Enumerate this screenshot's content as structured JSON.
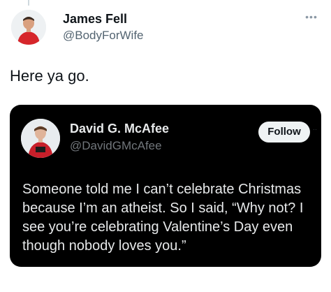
{
  "tweet": {
    "author": {
      "name": "James Fell",
      "handle": "@BodyForWife",
      "avatar_icon": "profile-photo-red-shirt"
    },
    "more_icon": "ellipsis-icon",
    "text": "Here ya go."
  },
  "quoted_tweet": {
    "author": {
      "name": "David G. McAfee",
      "handle": "@DavidGMcAfee",
      "avatar_icon": "profile-photo-red-shirt"
    },
    "follow_label": "Follow",
    "text_lines": [
      "Someone told me I can’t celebrate Christmas",
      "because I’m an atheist. So I said, “Why not? I",
      "see you’re celebrating Valentine’s Day even",
      "though nobody loves you.”"
    ]
  },
  "colors": {
    "card_background": "#000000",
    "follow_button_bg": "#eff3f4",
    "handle_gray": "#536471"
  }
}
